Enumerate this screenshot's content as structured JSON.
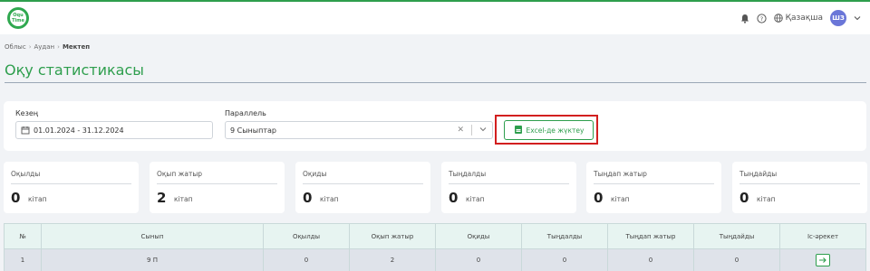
{
  "header": {
    "logo_text": "Oqu Time",
    "language": "Қазақша",
    "avatar_initials": "ШЗ"
  },
  "breadcrumb": [
    "Облыс",
    "Аудан",
    "Мектеп"
  ],
  "page_title": "Оқу статистикасы",
  "filters": {
    "period_label": "Кезең",
    "period_value": "01.01.2024 - 31.12.2024",
    "parallel_label": "Параллель",
    "parallel_value": "9 Сыныптар",
    "excel_button": "Excel-де жүктеу"
  },
  "stats": [
    {
      "label": "Оқылды",
      "value": "0",
      "unit": "кітап"
    },
    {
      "label": "Оқып жатыр",
      "value": "2",
      "unit": "кітап"
    },
    {
      "label": "Оқиды",
      "value": "0",
      "unit": "кітап"
    },
    {
      "label": "Тыңдалды",
      "value": "0",
      "unit": "кітап"
    },
    {
      "label": "Тыңдап жатыр",
      "value": "0",
      "unit": "кітап"
    },
    {
      "label": "Тыңдайды",
      "value": "0",
      "unit": "кітап"
    }
  ],
  "table": {
    "headers": [
      "№",
      "Сынып",
      "Оқылды",
      "Оқып жатыр",
      "Оқиды",
      "Тыңдалды",
      "Тыңдап жатыр",
      "Тыңдайды",
      "Іс-әрекет"
    ],
    "rows": [
      [
        "1",
        "9 П",
        "0",
        "2",
        "0",
        "0",
        "0",
        "0"
      ]
    ]
  },
  "colors": {
    "accent": "#2e9e4d",
    "highlight": "#d21f1f",
    "avatar": "#6a76d8"
  }
}
